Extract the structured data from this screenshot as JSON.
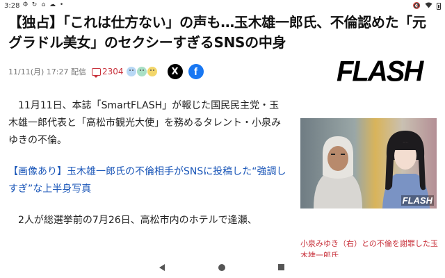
{
  "status_bar": {
    "time": "3:28",
    "left_icons": [
      "gear-icon",
      "refresh-icon",
      "home-icon",
      "cloud-icon",
      "dot-icon"
    ],
    "right_icons": [
      "mute-icon",
      "wifi-icon",
      "battery-icon"
    ]
  },
  "article": {
    "headline": "【独占】「これは仕方ない」の声も…玉木雄一郎氏、不倫認めた「元グラドル美女」のセクシーすぎるSNSの中身",
    "date": "11/11(月) 17:27 配信",
    "comment_count": "2304",
    "reaction_faces": [
      "#b8d8f5",
      "#a9e0c6",
      "#f3d66a"
    ],
    "share": {
      "x_label": "X",
      "facebook_label": "f"
    },
    "brand": "FLASH",
    "paragraph1": "11月11日、本誌「SmartFLASH」が報じた国民民主党・玉木雄一郎代表と「高松市観光大使」を務めるタレント・小泉みゆきの不倫。",
    "link_text": "【画像あり】玉木雄一郎氏の不倫相手がSNSに投稿した“強調しすぎ”な上半身写真",
    "paragraph3": "2人が総選挙前の7月26日、高松市内のホテルで逢瀬、",
    "photo_watermark": "FLASH",
    "photo_caption": "小泉みゆき（右）との不倫を謝罪した玉木雄一郎氏"
  },
  "colors": {
    "accent_red": "#c8313b",
    "link_blue": "#1a56b8",
    "facebook": "#1877f2"
  }
}
